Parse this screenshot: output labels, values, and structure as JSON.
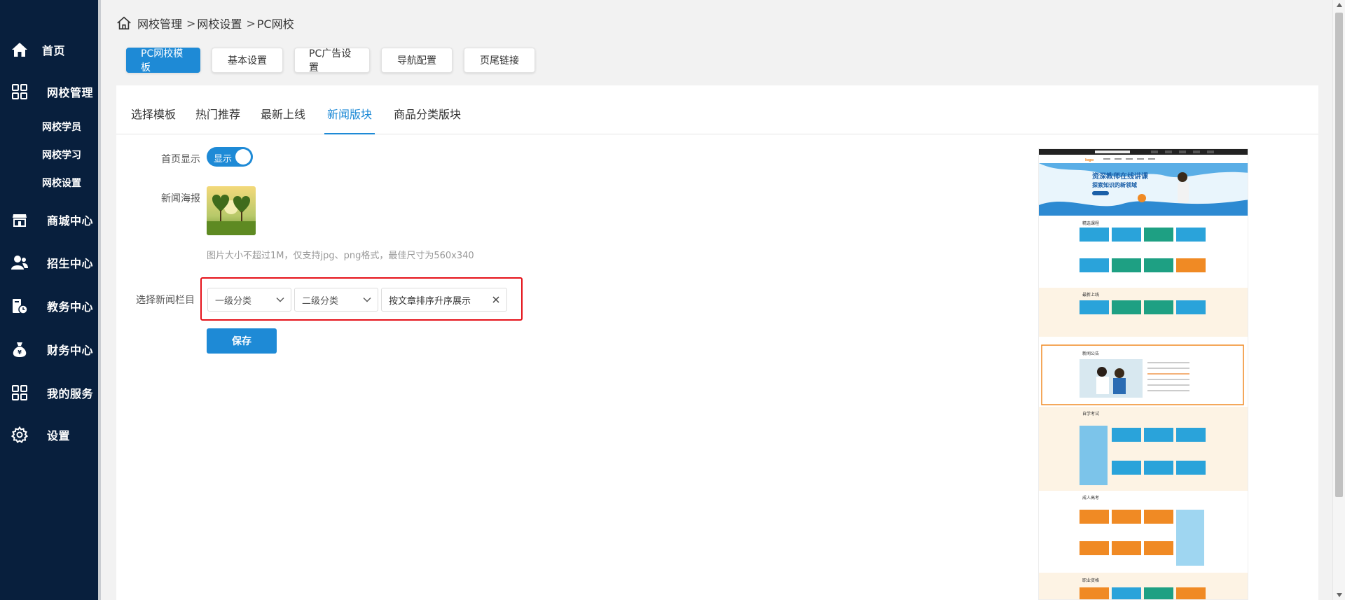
{
  "sidebar": {
    "items": [
      {
        "label": "首页",
        "icon": "home-icon"
      },
      {
        "label": "网校管理",
        "icon": "grid-icon"
      },
      {
        "label": "商城中心",
        "icon": "store-icon"
      },
      {
        "label": "招生中心",
        "icon": "users-icon"
      },
      {
        "label": "教务中心",
        "icon": "academic-icon"
      },
      {
        "label": "财务中心",
        "icon": "money-bag-icon"
      },
      {
        "label": "我的服务",
        "icon": "grid-icon"
      },
      {
        "label": "设置",
        "icon": "gear-icon"
      }
    ],
    "sub_items": [
      "网校学员",
      "网校学习",
      "网校设置"
    ]
  },
  "breadcrumb": {
    "items": [
      "网校管理",
      "网校设置",
      "PC网校"
    ],
    "separator": ">"
  },
  "top_buttons": [
    "PC网校模板",
    "基本设置",
    "PC广告设置",
    "导航配置",
    "页尾链接"
  ],
  "tabs": [
    "选择模板",
    "热门推荐",
    "最新上线",
    "新闻版块",
    "商品分类版块"
  ],
  "form": {
    "homepage_display": {
      "label": "首页显示",
      "toggle_text": "显示",
      "enabled": true
    },
    "poster": {
      "label": "新闻海报"
    },
    "hint": "图片大小不超过1M，仅支持jpg、png格式，最佳尺寸为560x340",
    "column": {
      "label": "选择新闻栏目",
      "level1_placeholder": "一级分类",
      "level2_placeholder": "二级分类",
      "sort_value": "按文章排序升序展示"
    },
    "save_label": "保存"
  },
  "preview": {
    "banner_line1": "资深教师在线讲课",
    "banner_line2": "探索知识的新领域",
    "logo_text": "logo",
    "sections": [
      "精选课程",
      "最新上线",
      "新闻公告",
      "自学考试",
      "成人高考",
      "职业资格"
    ]
  },
  "colors": {
    "sidebar_bg": "#081f3d",
    "accent": "#1e8ad6",
    "highlight_border": "#e5121a",
    "orange": "#f08a24"
  }
}
